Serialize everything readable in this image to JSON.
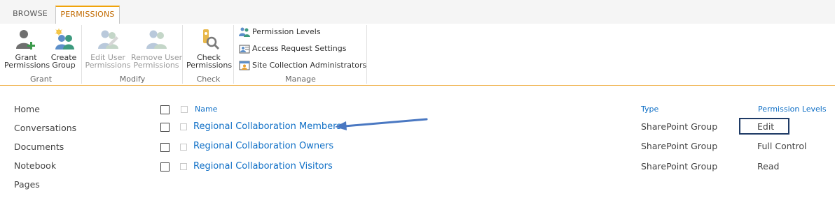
{
  "tabs": {
    "browse": "BROWSE",
    "permissions": "PERMISSIONS"
  },
  "ribbon": {
    "grant": {
      "label": "Grant",
      "grant_permissions": [
        "Grant",
        "Permissions"
      ],
      "create_group": [
        "Create",
        "Group"
      ]
    },
    "modify": {
      "label": "Modify",
      "edit_user_permissions": [
        "Edit User",
        "Permissions"
      ],
      "remove_user_permissions": [
        "Remove User",
        "Permissions"
      ]
    },
    "check": {
      "label": "Check",
      "check_permissions": [
        "Check",
        "Permissions"
      ]
    },
    "manage": {
      "label": "Manage",
      "permission_levels": "Permission Levels",
      "access_request_settings": "Access Request Settings",
      "site_collection_administrators": "Site Collection Administrators"
    }
  },
  "nav": [
    "Home",
    "Conversations",
    "Documents",
    "Notebook",
    "Pages"
  ],
  "table": {
    "headers": {
      "name": "Name",
      "type": "Type",
      "permission_levels": "Permission Levels"
    },
    "rows": [
      {
        "name": "Regional Collaboration Members",
        "type": "SharePoint Group",
        "permission": "Edit"
      },
      {
        "name": "Regional Collaboration Owners",
        "type": "SharePoint Group",
        "permission": "Full Control"
      },
      {
        "name": "Regional Collaboration Visitors",
        "type": "SharePoint Group",
        "permission": "Read"
      }
    ]
  },
  "colors": {
    "accent": "#f0a30a",
    "link": "#0f6fc6",
    "arrow": "#4a78c2",
    "highlight_box": "#1f3b66"
  }
}
